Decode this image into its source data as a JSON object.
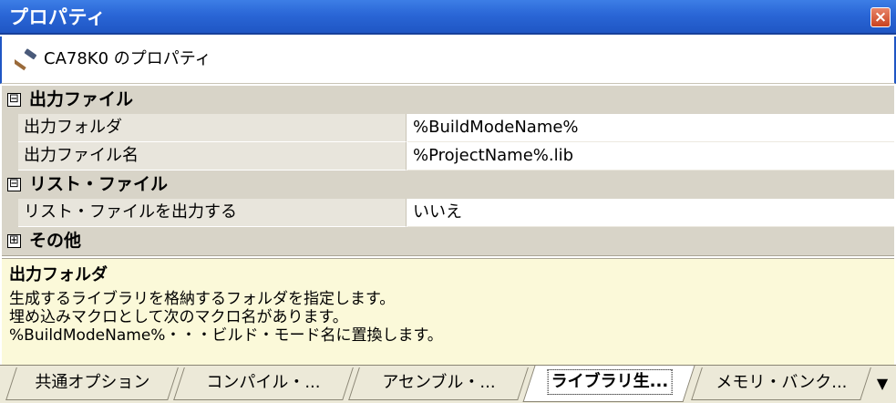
{
  "window": {
    "title": "プロパティ"
  },
  "heading": {
    "text": "CA78K0 のプロパティ"
  },
  "categories": [
    {
      "label": "出力ファイル",
      "expander": "⊟",
      "props": [
        {
          "name": "出力フォルダ",
          "value": "%BuildModeName%"
        },
        {
          "name": "出力ファイル名",
          "value": "%ProjectName%.lib"
        }
      ]
    },
    {
      "label": "リスト・ファイル",
      "expander": "⊟",
      "props": [
        {
          "name": "リスト・ファイルを出力する",
          "value": "いいえ"
        }
      ]
    },
    {
      "label": "その他",
      "expander": "⊞"
    }
  ],
  "description": {
    "title": "出力フォルダ",
    "lines": [
      "生成するライブラリを格納するフォルダを指定します。",
      "埋め込みマクロとして次のマクロ名があります。",
      "%BuildModeName%・・・ビルド・モード名に置換します。"
    ]
  },
  "tabs": [
    {
      "label": "共通オプション"
    },
    {
      "label": "コンパイル・..."
    },
    {
      "label": "アセンブル・..."
    },
    {
      "label": "ライブラリ生...",
      "active": true
    },
    {
      "label": "メモリ・バンク..."
    }
  ],
  "icons": {
    "close": "close-icon",
    "hammer": "hammer-icon",
    "tab_menu": "dropdown-arrow-icon"
  }
}
